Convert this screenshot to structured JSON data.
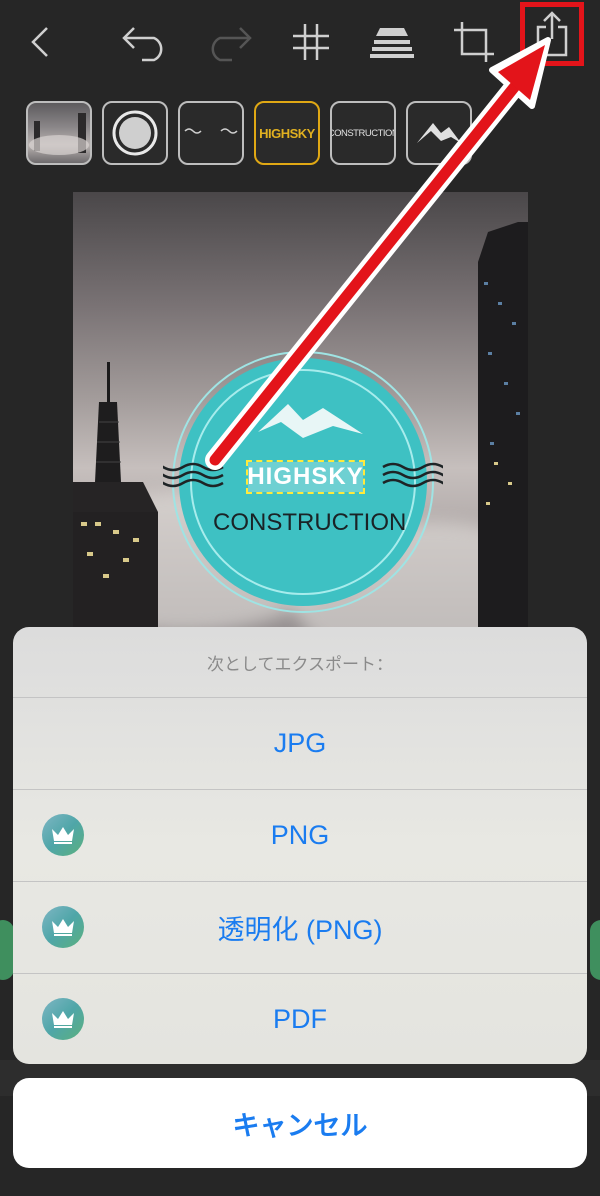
{
  "toolbar": {
    "icons": [
      "back-icon",
      "undo-icon",
      "redo-icon",
      "grid-icon",
      "layers-icon",
      "crop-icon",
      "share-icon"
    ]
  },
  "thumbnails": {
    "items": [
      {
        "type": "photo",
        "label": ""
      },
      {
        "type": "circle",
        "label": ""
      },
      {
        "type": "waves",
        "label": ""
      },
      {
        "type": "text",
        "label": "HIGHSKY",
        "selected": true
      },
      {
        "type": "text",
        "label": "CONSTRUCTION"
      },
      {
        "type": "mountains",
        "label": ""
      }
    ]
  },
  "canvas": {
    "logo_title": "HIGHSKY",
    "logo_subtitle": "CONSTRUCTION"
  },
  "sheet": {
    "title": "次としてエクスポート：",
    "options": [
      {
        "label": "JPG",
        "premium": false
      },
      {
        "label": "PNG",
        "premium": true
      },
      {
        "label": "透明化 (PNG)",
        "premium": true
      },
      {
        "label": "PDF",
        "premium": true
      }
    ],
    "cancel_label": "キャンセル"
  },
  "colors": {
    "accent_blue": "#1a7cf0",
    "highlight_red": "#e3141a",
    "selected_gold": "#e0a814",
    "logo_teal": "#3ec1c3"
  }
}
